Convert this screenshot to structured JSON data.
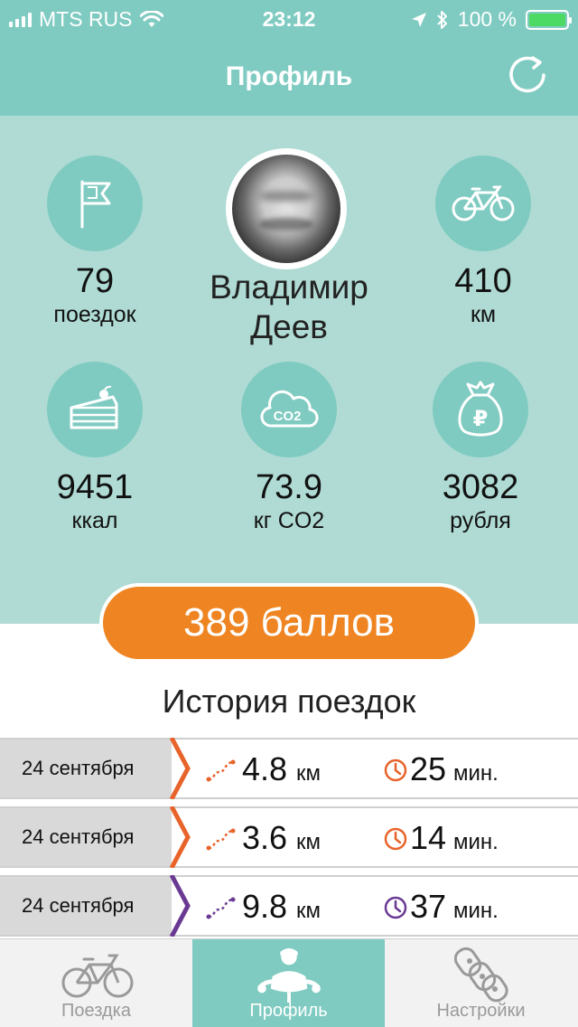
{
  "status_bar": {
    "carrier": "MTS RUS",
    "time": "23:12",
    "battery": "100 %",
    "battery_level": 1.0
  },
  "header": {
    "title": "Профиль"
  },
  "profile": {
    "name_first": "Владимир",
    "name_last": "Деев",
    "stats": {
      "rides": {
        "value": "79",
        "unit": "поездок",
        "icon": "flag-icon"
      },
      "distance": {
        "value": "410",
        "unit": "км",
        "icon": "bicycle-icon"
      },
      "calories": {
        "value": "9451",
        "unit": "ккал",
        "icon": "cake-icon"
      },
      "co2": {
        "value": "73.9",
        "unit": "кг CO2",
        "icon": "co2-cloud-icon",
        "icon_label": "CO2"
      },
      "money": {
        "value": "3082",
        "unit": "рубля",
        "icon": "money-bag-icon",
        "icon_label": "₽"
      }
    }
  },
  "points": {
    "label": "389 баллов"
  },
  "history": {
    "title": "История поездок",
    "trips": [
      {
        "date": "24 сентября",
        "distance": "4.8",
        "distance_unit": "км",
        "duration": "25",
        "duration_unit": "мин.",
        "color": "#e8632a"
      },
      {
        "date": "24 сентября",
        "distance": "3.6",
        "distance_unit": "км",
        "duration": "14",
        "duration_unit": "мин.",
        "color": "#e8632a"
      },
      {
        "date": "24 сентября",
        "distance": "9.8",
        "distance_unit": "км",
        "duration": "37",
        "duration_unit": "мин.",
        "color": "#6a3a93"
      }
    ]
  },
  "tab_bar": {
    "tabs": [
      {
        "label": "Поездка",
        "icon": "bicycle-icon",
        "active": false
      },
      {
        "label": "Профиль",
        "icon": "cyclist-icon",
        "active": true
      },
      {
        "label": "Настройки",
        "icon": "chain-icon",
        "active": false
      }
    ]
  },
  "colors": {
    "primary": "#7fcbc1",
    "panel": "#afdbd4",
    "accent": "#ef8522",
    "orange_route": "#e8632a",
    "purple_route": "#6a3a93",
    "battery": "#4cd964"
  }
}
